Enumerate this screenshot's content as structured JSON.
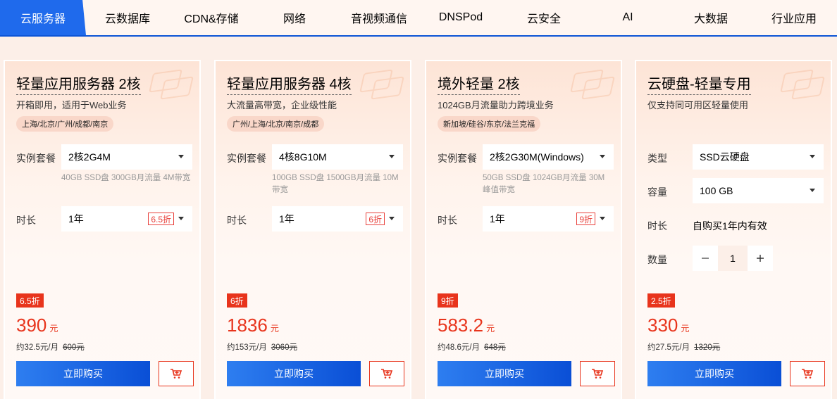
{
  "tabs": [
    "云服务器",
    "云数据库",
    "CDN&存储",
    "网络",
    "音视频通信",
    "DNSPod",
    "云安全",
    "AI",
    "大数据",
    "行业应用"
  ],
  "cards": [
    {
      "title": "轻量应用服务器 2核",
      "subtitle": "开箱即用，适用于Web业务",
      "region": "上海/北京/广州/成都/南京",
      "package_label": "实例套餐",
      "package_value": "2核2G4M",
      "package_desc": "40GB SSD盘 300GB月流量 4M带宽",
      "duration_label": "时长",
      "duration_value": "1年",
      "duration_discount": "6.5折",
      "badge": "6.5折",
      "price": "390",
      "price_unit": "元",
      "monthly": "约32.5元/月",
      "original": "600元",
      "buy_label": "立即购买"
    },
    {
      "title": "轻量应用服务器 4核",
      "subtitle": "大流量高带宽，企业级性能",
      "region": "广州/上海/北京/南京/成都",
      "package_label": "实例套餐",
      "package_value": "4核8G10M",
      "package_desc": "100GB SSD盘 1500GB月流量 10M带宽",
      "duration_label": "时长",
      "duration_value": "1年",
      "duration_discount": "6折",
      "badge": "6折",
      "price": "1836",
      "price_unit": "元",
      "monthly": "约153元/月",
      "original": "3060元",
      "buy_label": "立即购买"
    },
    {
      "title": "境外轻量 2核",
      "subtitle": "1024GB月流量助力跨境业务",
      "region": "新加坡/硅谷/东京/法兰克福",
      "package_label": "实例套餐",
      "package_value": "2核2G30M(Windows)",
      "package_desc": "50GB SSD盘 1024GB月流量 30M峰值带宽",
      "duration_label": "时长",
      "duration_value": "1年",
      "duration_discount": "9折",
      "badge": "9折",
      "price": "583.2",
      "price_unit": "元",
      "monthly": "约48.6元/月",
      "original": "648元",
      "buy_label": "立即购买"
    },
    {
      "title": "云硬盘-轻量专用",
      "subtitle": "仅支持同可用区轻量使用",
      "type_label": "类型",
      "type_value": "SSD云硬盘",
      "capacity_label": "容量",
      "capacity_value": "100 GB",
      "duration_label": "时长",
      "duration_value": "自购买1年内有效",
      "quantity_label": "数量",
      "quantity_value": "1",
      "badge": "2.5折",
      "price": "330",
      "price_unit": "元",
      "monthly": "约27.5元/月",
      "original": "1320元",
      "buy_label": "立即购买"
    }
  ],
  "colors": {
    "accent_blue": "#1f6aec",
    "price_red": "#e8341c"
  }
}
